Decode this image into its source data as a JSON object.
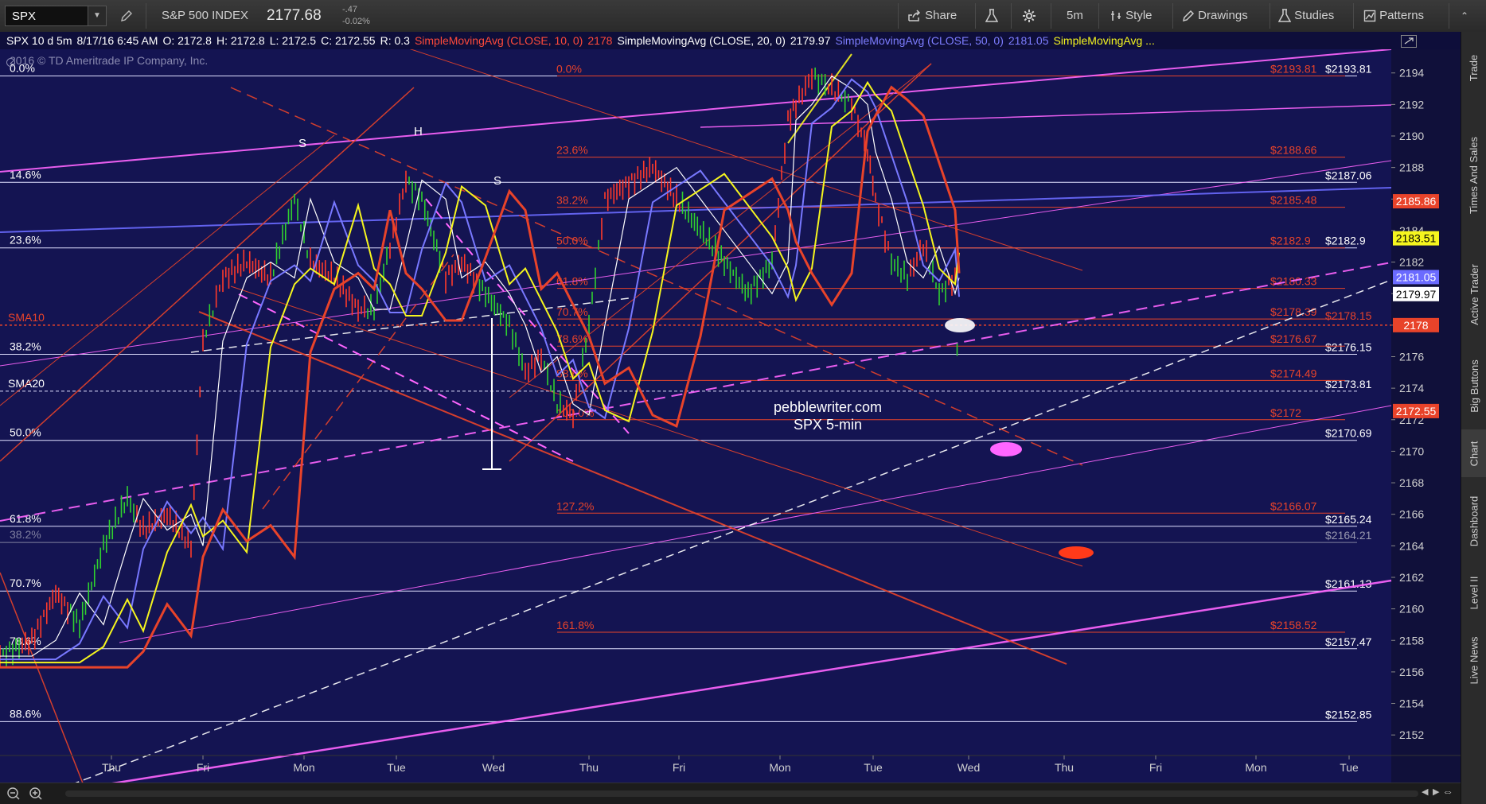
{
  "toolbar": {
    "symbol": "SPX",
    "symbol_name": "S&P 500 INDEX",
    "last_price": "2177.68",
    "net_change": "-.47",
    "pct_change": "-0.02%",
    "share": "Share",
    "timeframe": "5m",
    "style": "Style",
    "drawings": "Drawings",
    "studies": "Studies",
    "patterns": "Patterns"
  },
  "header": {
    "desc": "SPX 10 d 5m",
    "datetime": "8/17/16 6:45 AM",
    "open": "O: 2172.8",
    "high": "H: 2172.8",
    "low": "L: 2172.5",
    "close": "C: 2172.55",
    "range": "R: 0.3",
    "sma10_label": "SimpleMovingAvg (CLOSE, 10, 0)",
    "sma10_value": "2178",
    "sma20_label": "SimpleMovingAvg (CLOSE, 20, 0)",
    "sma20_value": "2179.97",
    "sma50_label": "SimpleMovingAvg (CLOSE, 50, 0)",
    "sma50_value": "2181.05",
    "sma_more": "SimpleMovingAvg ..."
  },
  "copyright": "2016 © TD Ameritrade IP Company, Inc.",
  "watermark": [
    "pebblewriter.com",
    "SPX 5-min"
  ],
  "colors": {
    "chart_bg": "#141452",
    "red": "#e8432a",
    "magenta": "#ff66ff",
    "blue": "#6b6bff",
    "yellow": "#f5f51e",
    "white": "#ffffff"
  },
  "y_axis": {
    "min": 2151,
    "max": 2195.5,
    "ticks": [
      2152,
      2154,
      2156,
      2158,
      2160,
      2162,
      2164,
      2166,
      2168,
      2170,
      2172,
      2174,
      2176,
      2178,
      2180,
      2182,
      2184,
      2186,
      2188,
      2190,
      2192,
      2194
    ]
  },
  "x_axis": [
    "Thu",
    "Fri",
    "Mon",
    "Tue",
    "Wed",
    "Thu",
    "Fri",
    "Mon",
    "Tue",
    "Wed",
    "Thu",
    "Fri",
    "Mon",
    "Tue"
  ],
  "fib_left": [
    {
      "label": "0.0%",
      "price": 2193.81
    },
    {
      "label": "14.6%",
      "price": 2187.06
    },
    {
      "label": "23.6%",
      "price": 2182.9
    },
    {
      "label": "38.2%",
      "price": 2176.15
    },
    {
      "label": "50.0%",
      "price": 2170.69
    },
    {
      "label": "61.8%",
      "price": 2165.24
    },
    {
      "label": "38.2%",
      "price": 2164.21
    },
    {
      "label": "70.7%",
      "price": 2161.13
    },
    {
      "label": "78.6%",
      "price": 2157.47
    },
    {
      "label": "88.6%",
      "price": 2152.85
    }
  ],
  "white_levels": [
    {
      "label": "$2193.81",
      "price": 2193.81
    },
    {
      "label": "$2187.06",
      "price": 2187.06
    },
    {
      "label": "$2182.9",
      "price": 2182.9
    },
    {
      "label": "$2176.15",
      "price": 2176.15
    },
    {
      "label": "$2173.81",
      "price": 2173.81
    },
    {
      "label": "$2170.69",
      "price": 2170.69
    },
    {
      "label": "$2165.24",
      "price": 2165.24
    },
    {
      "label": "$2164.21",
      "price": 2164.21
    },
    {
      "label": "$2161.13",
      "price": 2161.13
    },
    {
      "label": "$2157.47",
      "price": 2157.47
    },
    {
      "label": "$2152.85",
      "price": 2152.85
    }
  ],
  "red_levels": [
    {
      "label": "$2193.81",
      "price": 2193.81
    },
    {
      "label": "$2188.66",
      "price": 2188.66
    },
    {
      "label": "$2185.48",
      "price": 2185.48
    },
    {
      "label": "$2182.9",
      "price": 2182.9
    },
    {
      "label": "$2180.33",
      "price": 2180.33
    },
    {
      "label": "$2178.39",
      "price": 2178.39
    },
    {
      "label": "$2176.67",
      "price": 2176.67
    },
    {
      "label": "$2174.49",
      "price": 2174.49
    },
    {
      "label": "$2172",
      "price": 2172
    },
    {
      "label": "$2166.07",
      "price": 2166.07
    },
    {
      "label": "$2158.52",
      "price": 2158.52
    }
  ],
  "red_level_right_labels": [
    "$2178.15"
  ],
  "fib_mid": [
    {
      "label": "0.0%",
      "price": 2193.81
    },
    {
      "label": "23.6%",
      "price": 2188.66
    },
    {
      "label": "38.2%",
      "price": 2185.48
    },
    {
      "label": "50.0%",
      "price": 2182.9
    },
    {
      "label": "61.8%",
      "price": 2180.33
    },
    {
      "label": "70.7%",
      "price": 2178.39
    },
    {
      "label": "78.6%",
      "price": 2176.67
    },
    {
      "label": "88.6%",
      "price": 2174.49
    },
    {
      "label": "100.0%",
      "price": 2172
    },
    {
      "label": "127.2%",
      "price": 2166.07
    },
    {
      "label": "161.8%",
      "price": 2158.52
    }
  ],
  "sma_labels": [
    {
      "label": "SMA10",
      "price": 2178
    },
    {
      "label": "SMA20",
      "price": 2173.81
    }
  ],
  "price_badges": [
    {
      "text": "2185.86",
      "color": "#e8432a",
      "price": 2185.86
    },
    {
      "text": "2183.51",
      "color": "#f5f51e",
      "price": 2183.51
    },
    {
      "text": "2181.05",
      "color": "#6b6bff",
      "price": 2181.05
    },
    {
      "text": "2179.97",
      "color": "#ffffff",
      "price": 2179.97
    },
    {
      "text": "2178",
      "color": "#e8432a",
      "price": 2178
    },
    {
      "text": "2172.55",
      "color": "#e8432a",
      "price": 2172.55
    }
  ],
  "pattern_labels": [
    "S",
    "H",
    "S"
  ],
  "side_tabs": [
    "Trade",
    "Times And Sales",
    "Active Trader",
    "Big Buttons",
    "Chart",
    "Dashboard",
    "Level II",
    "Live News"
  ],
  "active_side_tab": "Chart"
}
